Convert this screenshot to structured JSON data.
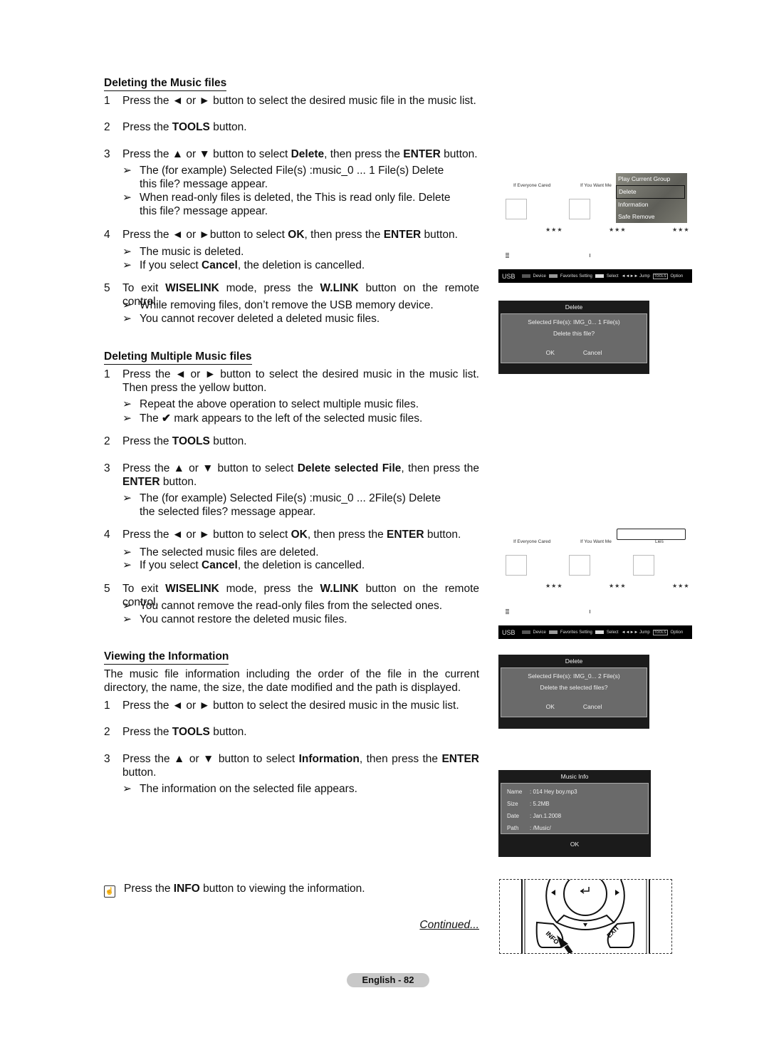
{
  "sec1": {
    "heading": "Deleting the Music files",
    "s1": {
      "num": "1",
      "runs": [
        [
          "Press the ◄ or ► button to select the desired music file in the music list.",
          0
        ]
      ]
    },
    "s2": {
      "num": "2",
      "runs": [
        [
          "Press the ",
          0
        ],
        [
          "TOOLS",
          1
        ],
        [
          " button.",
          0
        ]
      ]
    },
    "s3": {
      "num": "3",
      "runs": [
        [
          "Press the ▲ or ▼ button to select ",
          0
        ],
        [
          "Delete",
          1
        ],
        [
          ", then press the ",
          0
        ],
        [
          "ENTER",
          1
        ],
        [
          " button.",
          0
        ]
      ]
    },
    "n3a": "The (for example) Selected File(s) :music_0 ... 1 File(s) Delete this file? message appear.",
    "n3b": "When read-only files is deleted, the This is read only file. Delete this file? message appear.",
    "s4": {
      "num": "4",
      "runs": [
        [
          "Press the ◄ or ►button to select ",
          0
        ],
        [
          "OK",
          1
        ],
        [
          ", then press the ",
          0
        ],
        [
          "ENTER",
          1
        ],
        [
          " button.",
          0
        ]
      ]
    },
    "n4a": "The music is deleted.",
    "n4b": {
      "runs": [
        [
          "If you select ",
          0
        ],
        [
          "Cancel",
          1
        ],
        [
          ", the deletion is cancelled.",
          0
        ]
      ]
    },
    "s5": {
      "num": "5",
      "runs": [
        [
          "To exit ",
          0
        ],
        [
          "WISELINK",
          1
        ],
        [
          " mode, press the ",
          0
        ],
        [
          "W.LINK",
          1
        ],
        [
          " button on the remote control.",
          0
        ]
      ]
    },
    "n5a": "While removing files, don’t remove the USB memory device.",
    "n5b": "You cannot recover deleted a deleted music files."
  },
  "sec2": {
    "heading": "Deleting Multiple Music files",
    "s1": {
      "num": "1",
      "runs": [
        [
          "Press the ◄ or ► button to select the desired music in the music list. Then press the yellow button.",
          0
        ]
      ]
    },
    "n1a": "Repeat the above operation to select multiple music files.",
    "n1b_pre": "The",
    "n1b_post": "mark appears to the left of the selected music files.",
    "s2": {
      "num": "2",
      "runs": [
        [
          "Press the ",
          0
        ],
        [
          "TOOLS",
          1
        ],
        [
          " button.",
          0
        ]
      ]
    },
    "s3": {
      "num": "3",
      "runs": [
        [
          "Press the ▲ or ▼ button to select ",
          0
        ],
        [
          "Delete selected File",
          1
        ],
        [
          ", then press the ",
          0
        ],
        [
          "ENTER",
          1
        ],
        [
          " button.",
          0
        ]
      ]
    },
    "n3a": "The (for example) Selected File(s) :music_0 ... 2File(s) Delete the selected files? message appear.",
    "s4": {
      "num": "4",
      "runs": [
        [
          "Press the ◄ or ► button to select ",
          0
        ],
        [
          "OK",
          1
        ],
        [
          ", then press the ",
          0
        ],
        [
          "ENTER",
          1
        ],
        [
          " button.",
          0
        ]
      ]
    },
    "n4a": "The selected music files are deleted.",
    "n4b": {
      "runs": [
        [
          "If you select ",
          0
        ],
        [
          "Cancel",
          1
        ],
        [
          ", the deletion is cancelled.",
          0
        ]
      ]
    },
    "s5": {
      "num": "5",
      "runs": [
        [
          "To exit ",
          0
        ],
        [
          "WISELINK",
          1
        ],
        [
          " mode, press the ",
          0
        ],
        [
          "W.LINK",
          1
        ],
        [
          " button on the remote control.",
          0
        ]
      ]
    },
    "n5a": "You cannot remove the read-only files from the selected ones.",
    "n5b": "You cannot restore the deleted music files."
  },
  "sec3": {
    "heading": "Viewing the Information",
    "para": "The music file information including the order of the file in the current directory, the name, the size, the date modified and the path is displayed.",
    "s1": {
      "num": "1",
      "runs": [
        [
          "Press the ◄ or ► button to select the desired music in the music list.",
          0
        ]
      ]
    },
    "s2": {
      "num": "2",
      "runs": [
        [
          "Press the ",
          0
        ],
        [
          "TOOLS",
          1
        ],
        [
          " button.",
          0
        ]
      ]
    },
    "s3": {
      "num": "3",
      "runs": [
        [
          "Press the ▲ or ▼ button to select ",
          0
        ],
        [
          "Information",
          1
        ],
        [
          ", then press the ",
          0
        ],
        [
          "ENTER",
          1
        ],
        [
          " button.",
          0
        ]
      ]
    },
    "n3a": "The information on the selected file appears."
  },
  "arrow": "➢",
  "info_note": {
    "runs": [
      [
        "Press the ",
        0
      ],
      [
        "INFO",
        1
      ],
      [
        " button to viewing the information.",
        0
      ]
    ]
  },
  "continued": "Continued...",
  "footer": "English - 82",
  "screen1": {
    "titles": [
      "If Everyone Cared",
      "If You Want Me"
    ],
    "stars": "★★★",
    "menu": [
      "Play Current Group",
      "Delete",
      "Information",
      "Safe Remove"
    ],
    "selected_menu": "Delete"
  },
  "screen2": {
    "titles": [
      "If Everyone Cared",
      "If You Want Me",
      "Lies"
    ],
    "stars": "★★★"
  },
  "bar": {
    "source": "USB",
    "device": "Device",
    "fav": "Favorites Setting",
    "select": "Select",
    "jump": "◄◄►► Jump",
    "tools": "TOOLS",
    "option": "Option",
    "colors": {
      "device": "#555555",
      "fav": "#999999",
      "select": "#dddddd"
    }
  },
  "dialog1": {
    "title": "Delete",
    "files": "Selected File(s): IMG_0...    1 File(s)",
    "question": "Delete this file?",
    "ok": "OK",
    "cancel": "Cancel"
  },
  "dialog2": {
    "title": "Delete",
    "files": "Selected File(s): IMG_0...    2 File(s)",
    "question": "Delete the selected files?",
    "ok": "OK",
    "cancel": "Cancel"
  },
  "music_info": {
    "title": "Music Info",
    "rows": [
      {
        "k": "Name",
        "v": ": 014 Hey boy.mp3"
      },
      {
        "k": "Size",
        "v": ": 5.2MB"
      },
      {
        "k": "Date",
        "v": ": Jan.1.2008"
      },
      {
        "k": "Path",
        "v": ": /Music/"
      }
    ],
    "ok": "OK"
  },
  "remote": {
    "info": "INFO",
    "exit": "EXIT"
  }
}
